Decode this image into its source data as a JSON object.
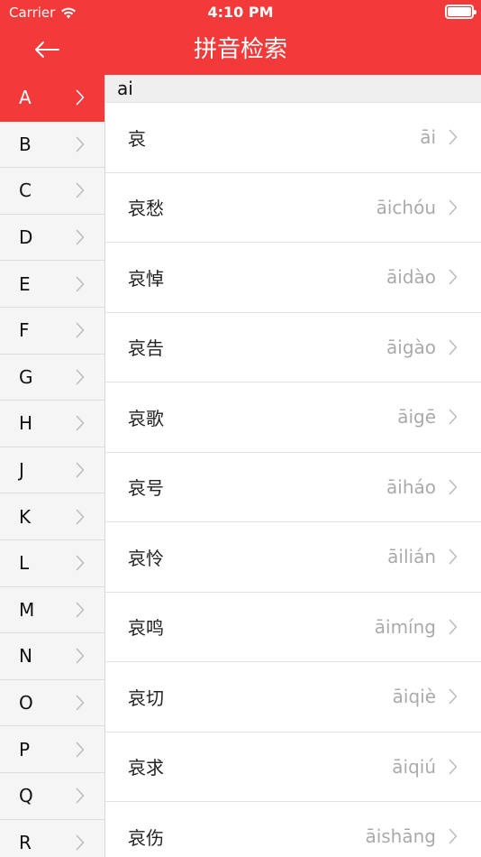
{
  "status_bar": {
    "carrier": "Carrier",
    "time": "4:10 PM"
  },
  "nav": {
    "title": "拼音检索"
  },
  "colors": {
    "accent": "#f23a3a",
    "sidebar_bg": "#f5f5f5",
    "section_bg": "#efefef",
    "pinyin_gray": "#aaaaaa"
  },
  "icons": {
    "back": "arrow-left-icon",
    "row_chevron": "chevron-right-icon",
    "wifi": "wifi-icon",
    "battery": "battery-icon"
  },
  "sidebar": {
    "active_index": 0,
    "letters": [
      "A",
      "B",
      "C",
      "D",
      "E",
      "F",
      "G",
      "H",
      "J",
      "K",
      "L",
      "M",
      "N",
      "O",
      "P",
      "Q",
      "R"
    ]
  },
  "content": {
    "section_label": "ai",
    "words": [
      {
        "word": "哀",
        "pinyin": "āi"
      },
      {
        "word": "哀愁",
        "pinyin": "āichóu"
      },
      {
        "word": "哀悼",
        "pinyin": "āidào"
      },
      {
        "word": "哀告",
        "pinyin": "āigào"
      },
      {
        "word": "哀歌",
        "pinyin": "āigē"
      },
      {
        "word": "哀号",
        "pinyin": "āiháo"
      },
      {
        "word": "哀怜",
        "pinyin": "āilián"
      },
      {
        "word": "哀鸣",
        "pinyin": "āimíng"
      },
      {
        "word": "哀切",
        "pinyin": "āiqiè"
      },
      {
        "word": "哀求",
        "pinyin": "āiqiú"
      },
      {
        "word": "哀伤",
        "pinyin": "āishāng"
      }
    ]
  }
}
